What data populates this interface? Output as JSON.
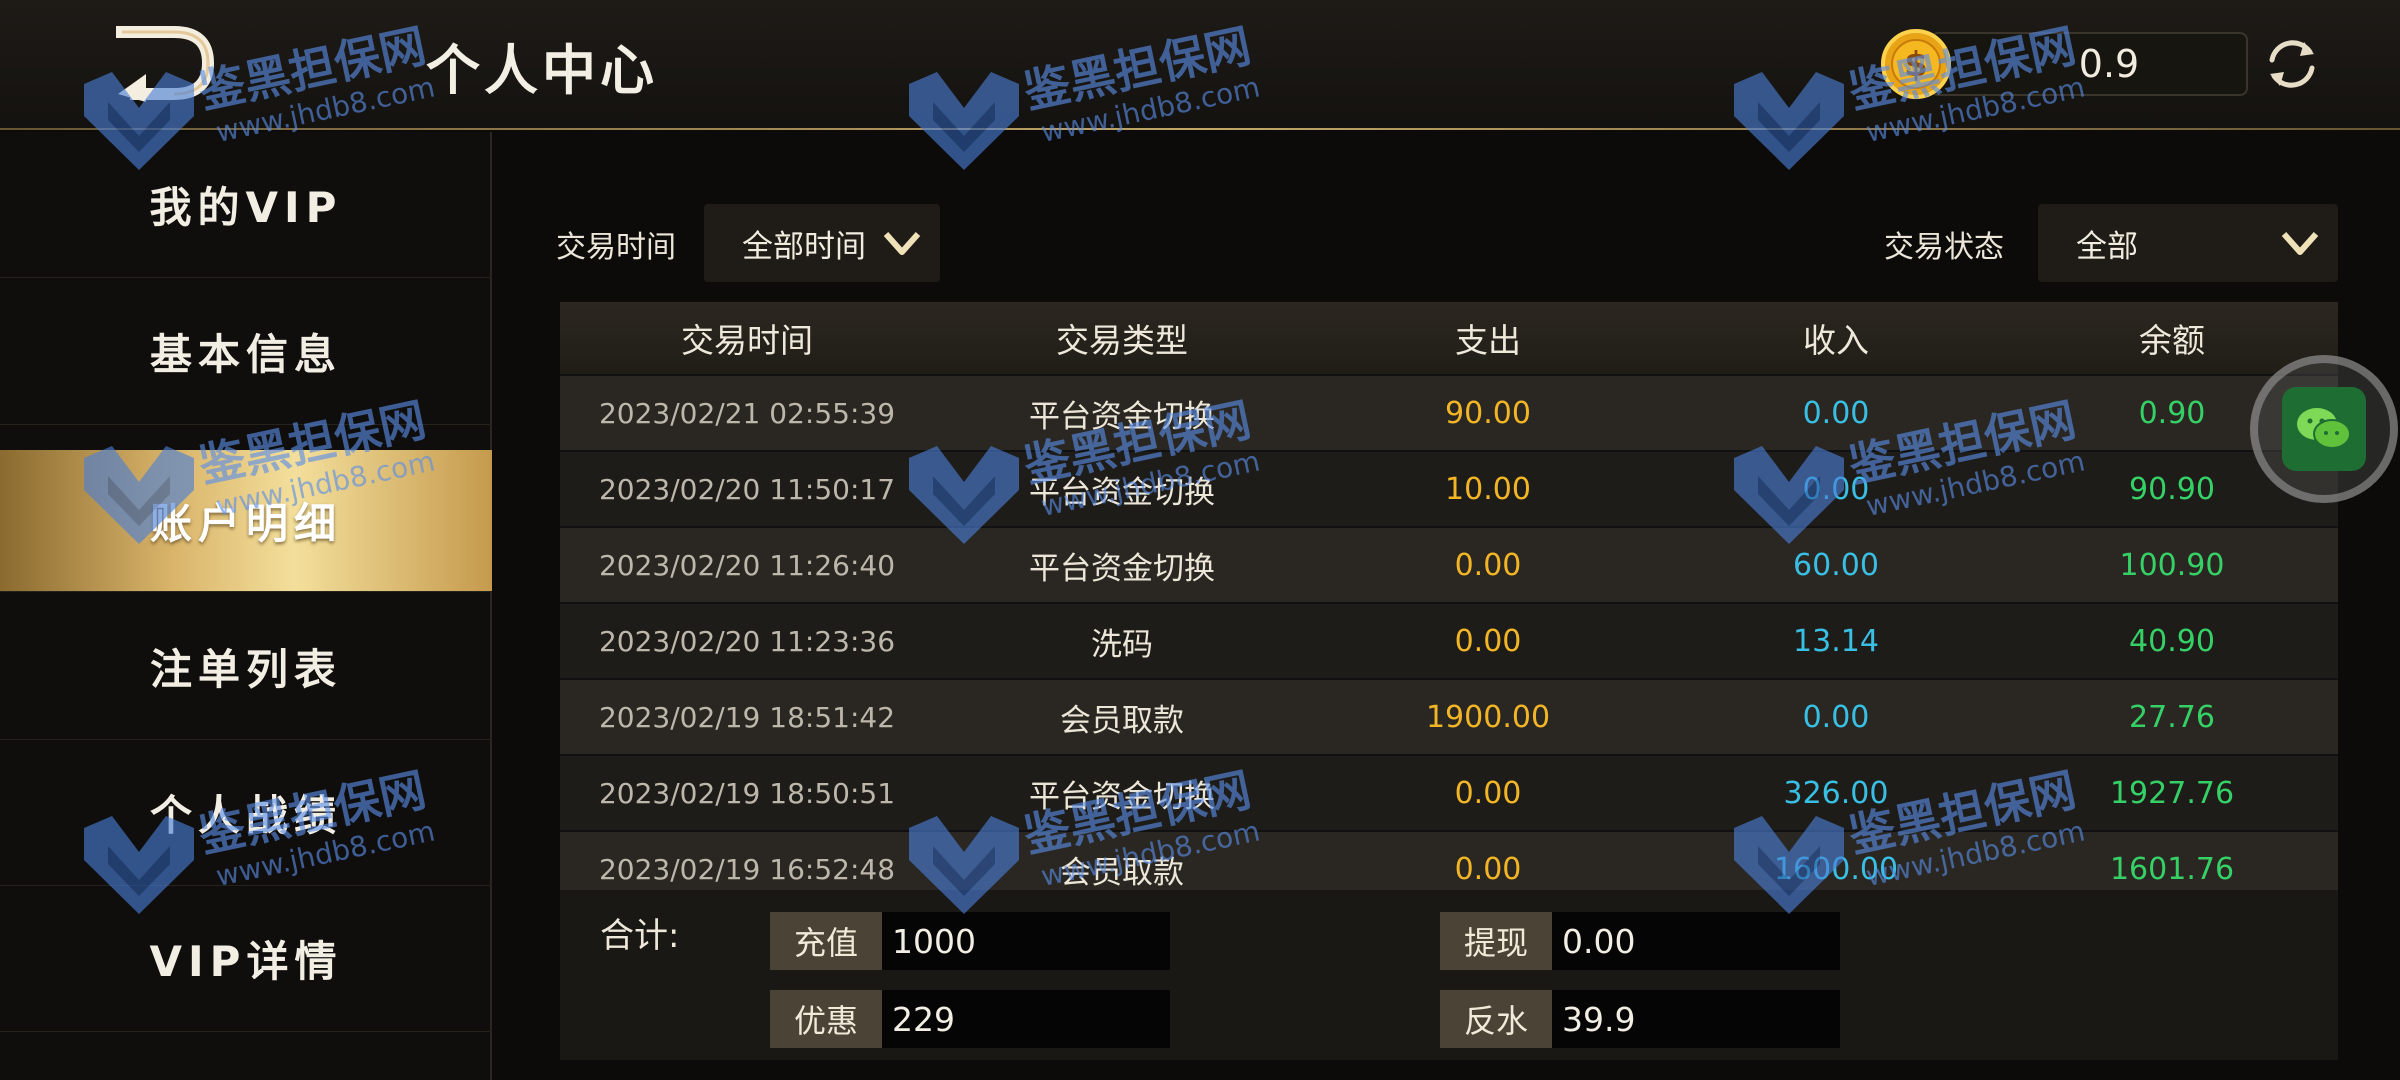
{
  "header": {
    "title": "个人中心",
    "balance": "0.9"
  },
  "sidebar": {
    "items": [
      {
        "label": "我的VIP"
      },
      {
        "label": "基本信息"
      },
      {
        "label": "账户明细"
      },
      {
        "label": "注单列表"
      },
      {
        "label": "个人战绩"
      },
      {
        "label": "VIP详情"
      }
    ]
  },
  "filters": {
    "time_label": "交易时间",
    "time_value": "全部时间",
    "status_label": "交易状态",
    "status_value": "全部"
  },
  "table": {
    "headers": [
      "交易时间",
      "交易类型",
      "支出",
      "收入",
      "余额"
    ],
    "rows": [
      [
        "2023/02/21 02:55:39",
        "平台资金切换",
        "90.00",
        "0.00",
        "0.90"
      ],
      [
        "2023/02/20 11:50:17",
        "平台资金切换",
        "10.00",
        "0.00",
        "90.90"
      ],
      [
        "2023/02/20 11:26:40",
        "平台资金切换",
        "0.00",
        "60.00",
        "100.90"
      ],
      [
        "2023/02/20 11:23:36",
        "洗码",
        "0.00",
        "13.14",
        "40.90"
      ],
      [
        "2023/02/19 18:51:42",
        "会员取款",
        "1900.00",
        "0.00",
        "27.76"
      ],
      [
        "2023/02/19 18:50:51",
        "平台资金切换",
        "0.00",
        "326.00",
        "1927.76"
      ],
      [
        "2023/02/19 16:52:48",
        "会员取款",
        "0.00",
        "1600.00",
        "1601.76"
      ]
    ]
  },
  "summary": {
    "label": "合计:",
    "recharge_tag": "充值",
    "recharge_value": "1000",
    "withdraw_tag": "提现",
    "withdraw_value": "0.00",
    "bonus_tag": "优惠",
    "bonus_value": "229",
    "rebate_tag": "反水",
    "rebate_value": "39.9"
  },
  "watermark": {
    "cn": "鉴黑担保网",
    "url": "www.jhdb8.com"
  },
  "colors": {
    "accent_gold": "#d9b46a",
    "expense": "#f2b526",
    "income": "#38bfe3",
    "balance": "#35d167"
  }
}
